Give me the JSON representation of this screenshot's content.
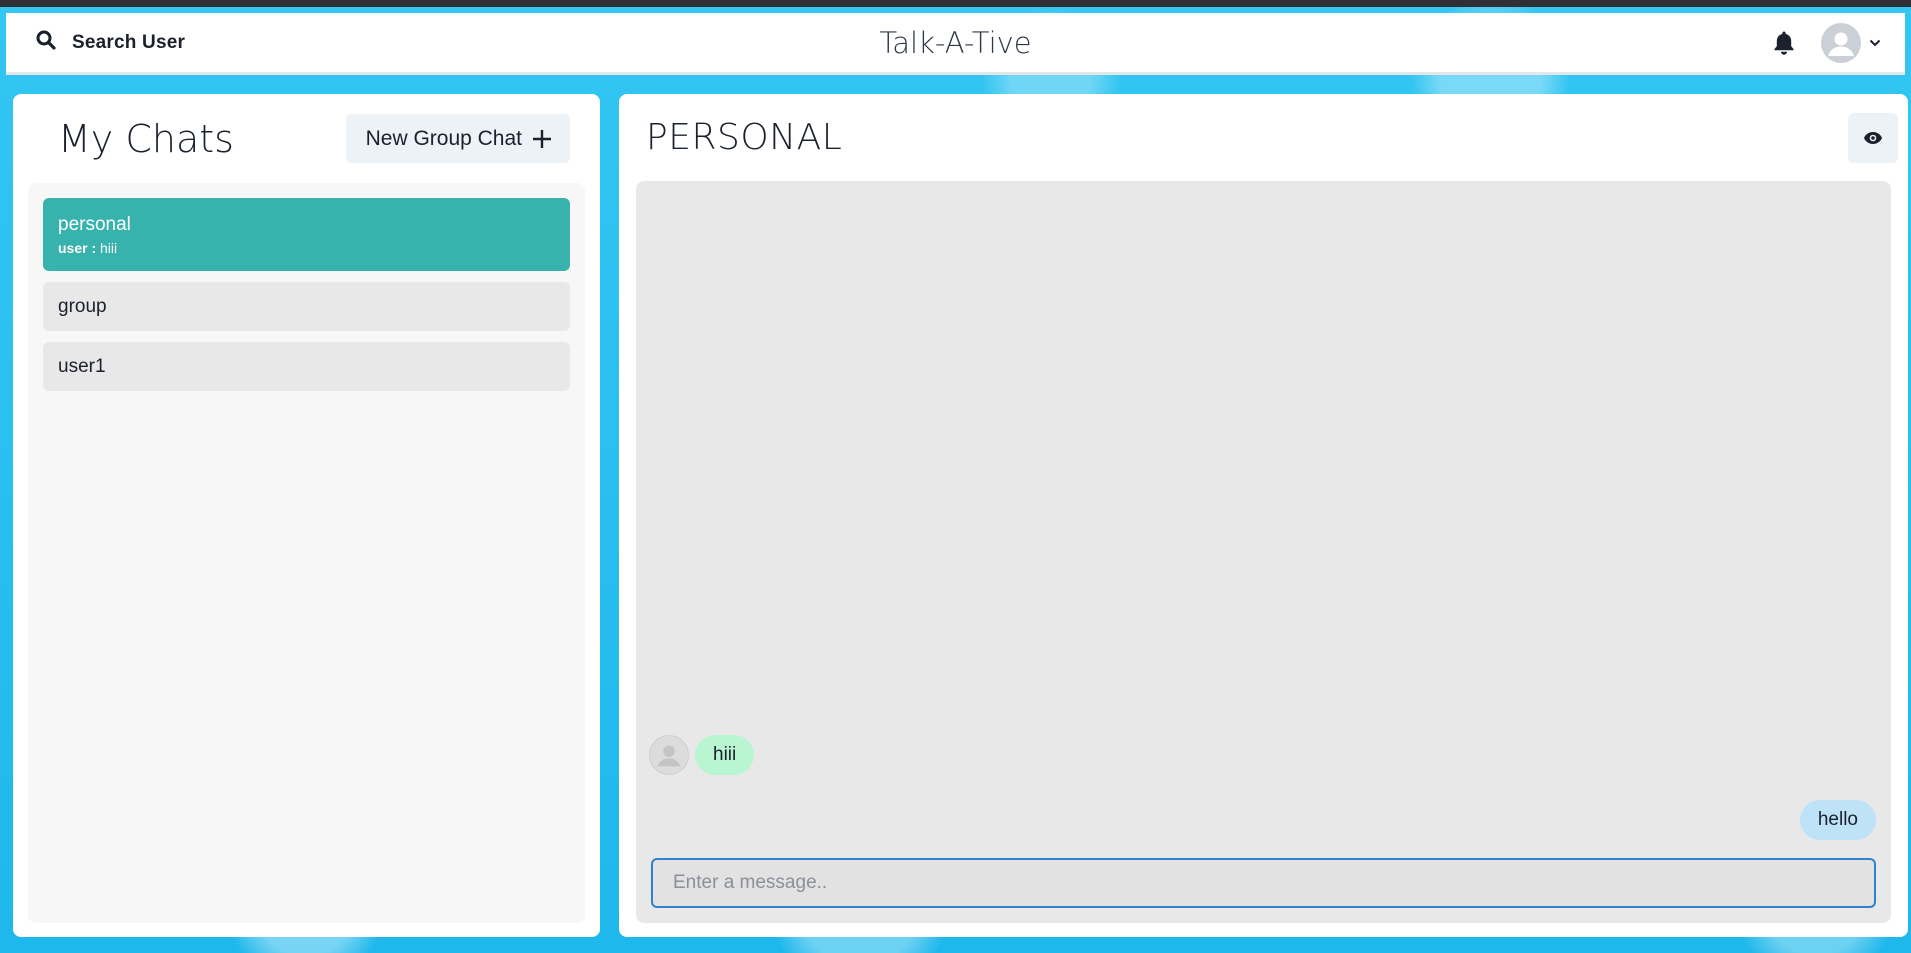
{
  "header": {
    "search_label": "Search User",
    "search_icon": "search-icon",
    "app_title": "Talk-A-Tive",
    "bell_icon": "bell-icon",
    "avatar_icon": "user-avatar-icon",
    "menu_icon": "chevron-down-icon"
  },
  "chats_panel": {
    "title": "My Chats",
    "new_group_label": "New Group Chat",
    "new_group_icon": "plus-icon",
    "items": [
      {
        "name": "personal",
        "latest_sender": "user :",
        "latest_message": "hiii",
        "active": true
      },
      {
        "name": "group",
        "active": false
      },
      {
        "name": "user1",
        "active": false
      }
    ]
  },
  "chat_window": {
    "title": "PERSONAL",
    "eye_icon": "eye-icon",
    "messages": [
      {
        "text": "hiii",
        "direction": "incoming",
        "show_avatar": true
      },
      {
        "text": "hello",
        "direction": "outgoing",
        "show_avatar": false
      }
    ],
    "input_placeholder": "Enter a message.."
  },
  "colors": {
    "accent_active_chat": "#38b2ac",
    "incoming_bubble": "#b9f5d0",
    "outgoing_bubble": "#bee3f8",
    "input_border": "#3182ce",
    "background": "#2ec4f1"
  }
}
